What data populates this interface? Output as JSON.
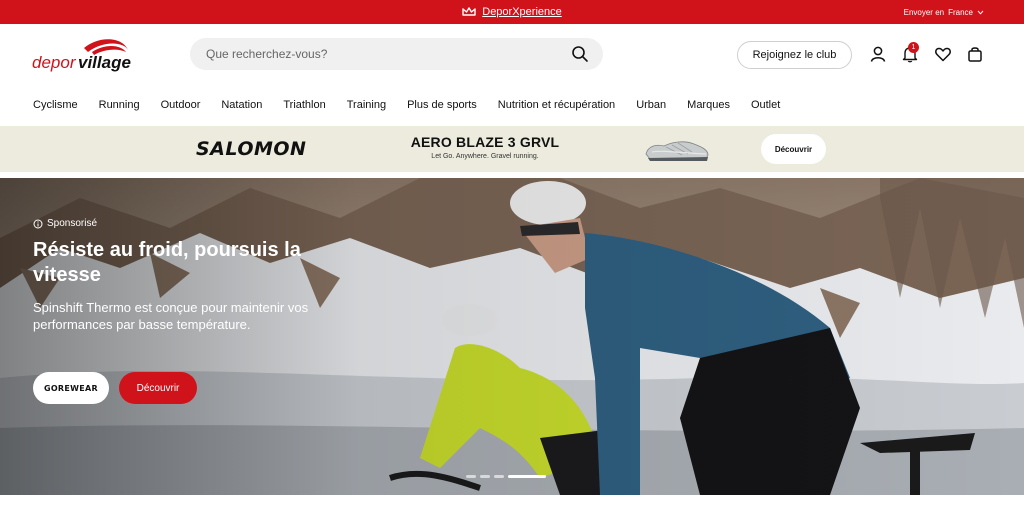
{
  "topbar": {
    "promo_link": "DeporXperience",
    "shipping_label": "Envoyer en",
    "shipping_country": "France",
    "bg_color": "#d0121b"
  },
  "header": {
    "logo_left": "depor",
    "logo_right": "village",
    "search_placeholder": "Que recherchez-vous?",
    "club_button": "Rejoignez le club",
    "notification_count": "1",
    "icons": [
      "search-icon",
      "user-icon",
      "bell-icon",
      "heart-icon",
      "bag-icon"
    ]
  },
  "nav": {
    "items": [
      "Cyclisme",
      "Running",
      "Outdoor",
      "Natation",
      "Triathlon",
      "Training",
      "Plus de sports",
      "Nutrition et récupération",
      "Urban",
      "Marques",
      "Outlet"
    ]
  },
  "promo": {
    "brand": "SALOMON",
    "title": "AERO BLAZE 3 GRVL",
    "subtitle": "Let Go. Anywhere. Gravel running.",
    "button": "Découvrir",
    "bg_color": "#ecebde"
  },
  "hero": {
    "sponsored": "Sponsorisé",
    "title": "Résiste au froid, poursuis la vitesse",
    "description": "Spinshift Thermo est conçue pour maintenir vos performances par basse température.",
    "brand_button": "GOREWEAR",
    "cta_button": "Découvrir",
    "cta_color": "#d0121b",
    "slides": 4,
    "active_slide": 4
  }
}
